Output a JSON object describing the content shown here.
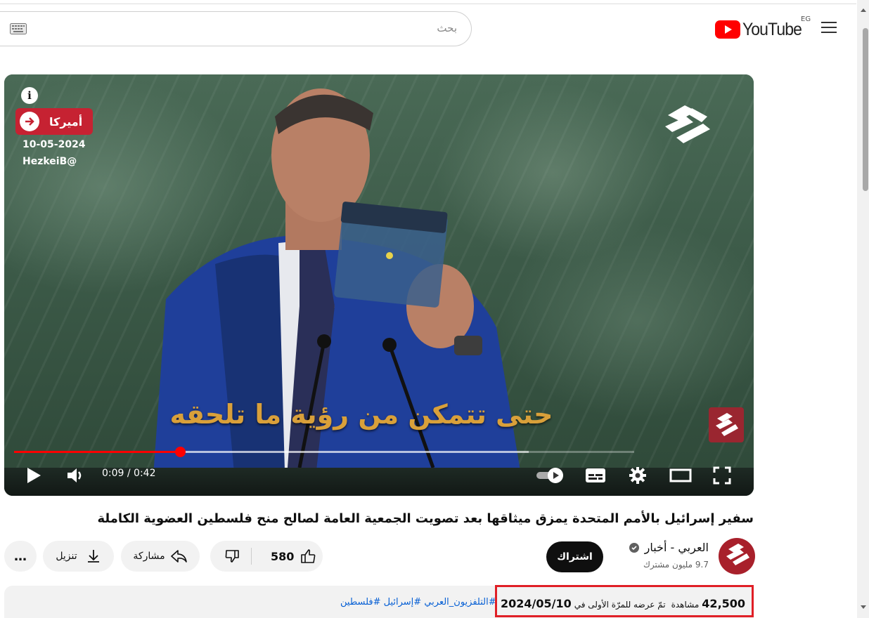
{
  "header": {
    "search_placeholder": "بحث",
    "logo_text": "YouTube",
    "region": "EG",
    "icons": [
      "keyboard-icon",
      "youtube-play-icon",
      "menu-icon"
    ]
  },
  "player": {
    "info_label": "i",
    "tag_label": "أميركا",
    "overlay_date": "10-05-2024",
    "overlay_handle": "HezkeiB@",
    "caption": "حتى تتمكن من رؤية ما تلحقه",
    "time": "0:09 / 0:42",
    "progress": 0.268,
    "buffered": 0.83,
    "icons": [
      "play-icon",
      "volume-icon",
      "autoplay-toggle-icon",
      "subtitles-icon",
      "settings-icon",
      "theater-icon",
      "fullscreen-icon"
    ]
  },
  "video": {
    "title": "سفير إسرائيل بالأمم المتحدة يمزق ميثاقها بعد تصويت الجمعية العامة لصالح منح فلسطين العضوية الكاملة"
  },
  "actions": {
    "likes": "580",
    "share_label": "مشاركة",
    "download_label": "تنزيل",
    "more_label": "…"
  },
  "channel": {
    "name": "العربي - أخبار",
    "subscribers": "9.7 مليون مشترك",
    "subscribe_label": "اشتراك",
    "avatar_text": "التلفزيون العربي"
  },
  "description": {
    "views": "42,500",
    "views_label": "مشاهدة",
    "premiere_label": "تمّ عرضه للمرّة الأولى في",
    "date": "2024/05/10",
    "hashtags": "#التلفزيون_العربي #إسرائيل #فلسطين"
  },
  "colors": {
    "accent_red": "#ff0000",
    "highlight_red": "#e01f26",
    "link_blue": "#065fd4",
    "tag_red": "#c62232"
  }
}
